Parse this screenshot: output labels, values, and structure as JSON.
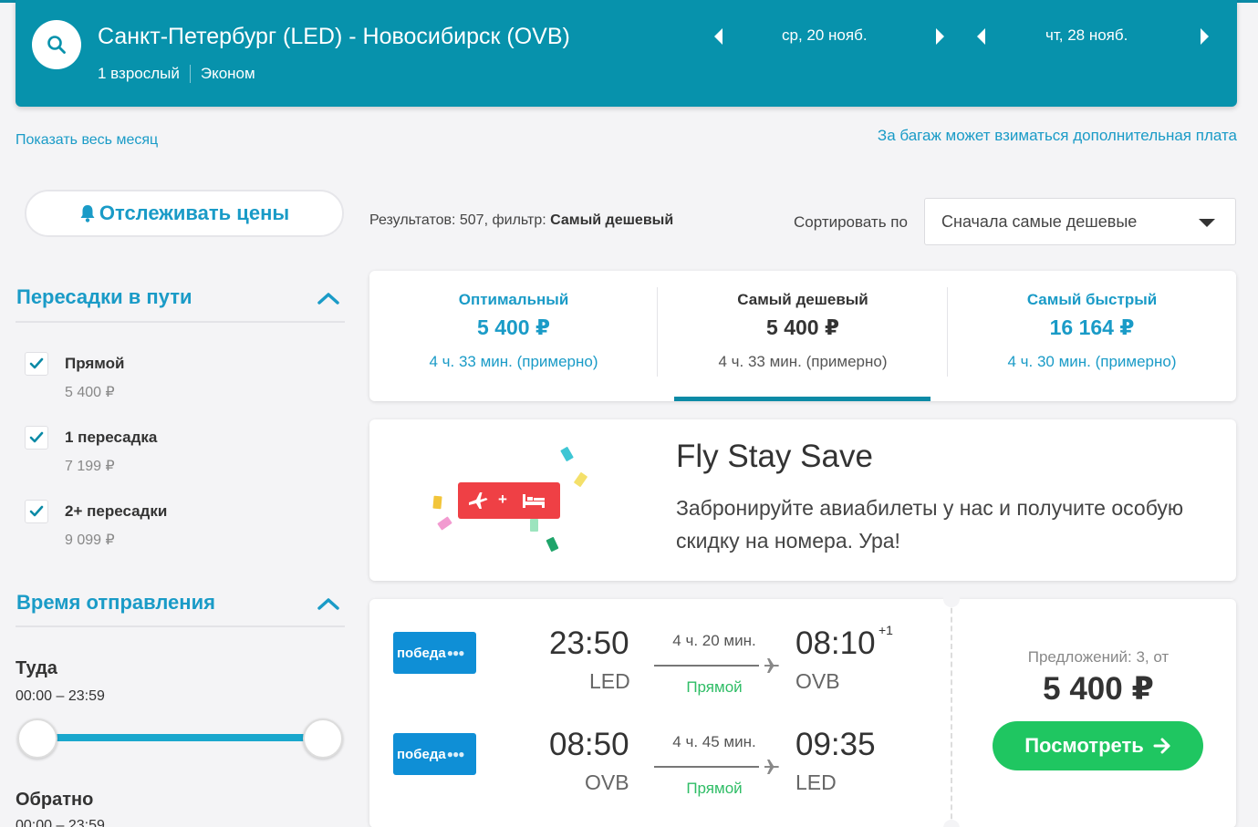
{
  "header": {
    "route": "Санкт-Петербург (LED) - Новосибирск (OVB)",
    "passengers": "1 взрослый",
    "cabin": "Эконом",
    "depart_date": "ср, 20 нояб.",
    "return_date": "чт, 28 нояб."
  },
  "links": {
    "show_month": "Показать весь месяц",
    "baggage_note": "За багаж может взиматься дополнительная плата"
  },
  "track_button": "Отслеживать цены",
  "results": {
    "prefix": "Результатов: 507, фильтр: ",
    "filter": "Самый дешевый"
  },
  "sort": {
    "label": "Сортировать по",
    "selected": "Сначала самые дешевые"
  },
  "filters": {
    "stops_title": "Пересадки в пути",
    "stops": [
      {
        "label": "Прямой",
        "price": "5 400 ₽",
        "checked": true
      },
      {
        "label": "1 пересадка",
        "price": "7 199 ₽",
        "checked": true
      },
      {
        "label": "2+ пересадки",
        "price": "9 099 ₽",
        "checked": true
      }
    ],
    "departure_title": "Время отправления",
    "outbound_label": "Туда",
    "outbound_range": "00:00 – 23:59",
    "return_label": "Обратно",
    "return_range": "00:00 – 23:59"
  },
  "tabs": [
    {
      "title": "Оптимальный",
      "price": "5 400 ₽",
      "duration": "4 ч. 33 мин. (примерно)",
      "active": false
    },
    {
      "title": "Самый дешевый",
      "price": "5 400 ₽",
      "duration": "4 ч. 33 мин. (примерно)",
      "active": true
    },
    {
      "title": "Самый быстрый",
      "price": "16 164 ₽",
      "duration": "4 ч. 30 мин. (примерно)",
      "active": false
    }
  ],
  "promo": {
    "title": "Fly Stay Save",
    "text": "Забронируйте авиабилеты у нас и получите особую скидку на номера. Ура!"
  },
  "flight": {
    "airline": "победа",
    "legs": [
      {
        "dep_time": "23:50",
        "dep_code": "LED",
        "duration": "4 ч. 20 мин.",
        "stops": "Прямой",
        "arr_time": "08:10",
        "arr_code": "OVB",
        "day_offset": "+1"
      },
      {
        "dep_time": "08:50",
        "dep_code": "OVB",
        "duration": "4 ч. 45 мин.",
        "stops": "Прямой",
        "arr_time": "09:35",
        "arr_code": "LED",
        "day_offset": ""
      }
    ],
    "offers": "Предложений: 3, от",
    "price": "5 400 ₽",
    "view_button": "Посмотреть"
  },
  "colors": {
    "header_bg": "#0792ac",
    "accent": "#1a9bc7",
    "cta": "#1fc661",
    "airline": "#0f8fd6"
  }
}
